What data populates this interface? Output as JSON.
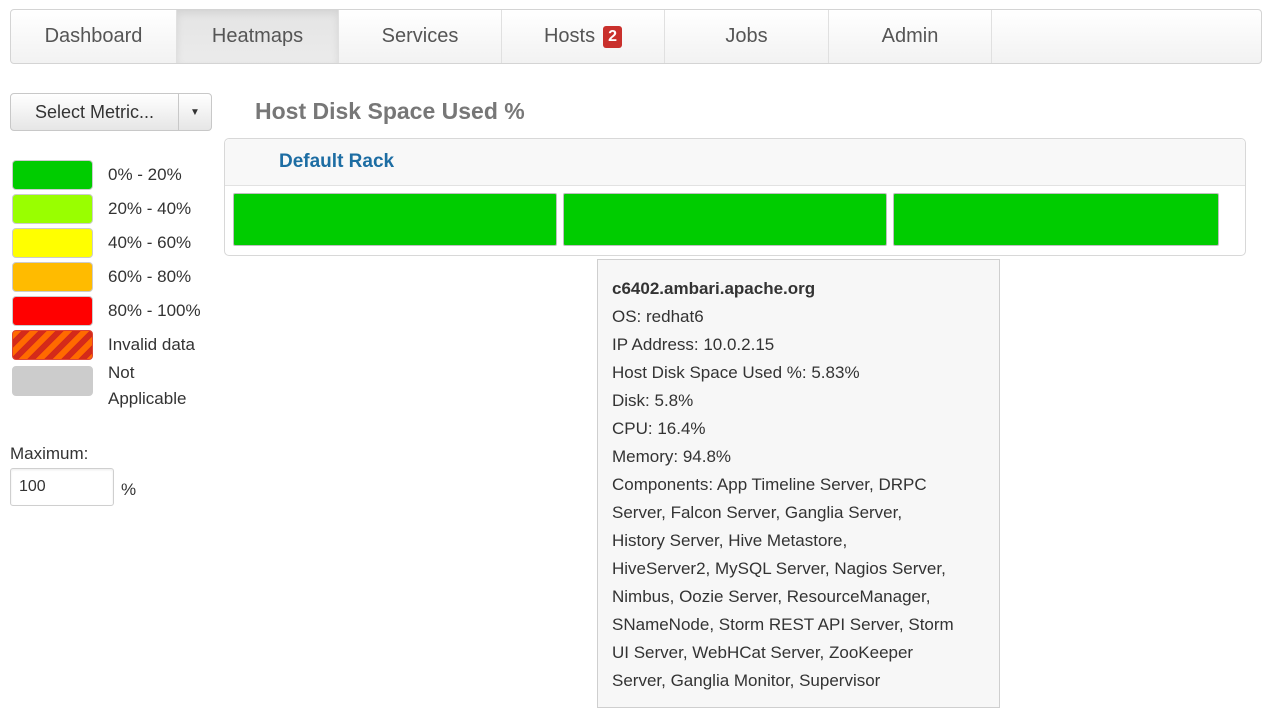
{
  "nav": {
    "items": [
      {
        "label": "Dashboard",
        "active": false
      },
      {
        "label": "Heatmaps",
        "active": true
      },
      {
        "label": "Services",
        "active": false
      },
      {
        "label": "Hosts",
        "active": false,
        "badge": "2"
      },
      {
        "label": "Jobs",
        "active": false
      },
      {
        "label": "Admin",
        "active": false
      }
    ]
  },
  "metric_select": {
    "label": "Select Metric..."
  },
  "legend": [
    {
      "label": "0% - 20%",
      "color": "#00cc00"
    },
    {
      "label": "20% - 40%",
      "color": "#99ff00"
    },
    {
      "label": "40% - 60%",
      "color": "#ffff00"
    },
    {
      "label": "60% - 80%",
      "color": "#ffbb00"
    },
    {
      "label": "80% - 100%",
      "color": "#ff0000"
    },
    {
      "label": "Invalid data",
      "color": "hatched"
    },
    {
      "label_line1": "Not",
      "label_line2": "Applicable",
      "color": "#cccccc"
    }
  ],
  "maximum": {
    "label": "Maximum:",
    "value": "100",
    "unit": "%"
  },
  "main": {
    "title": "Host Disk Space Used %",
    "rack": {
      "title": "Default Rack",
      "hosts": [
        {
          "color": "#00cc00"
        },
        {
          "color": "#00cc00"
        },
        {
          "color": "#00cc00"
        }
      ]
    }
  },
  "tooltip": {
    "host_name": "c6402.ambari.apache.org",
    "os": "OS: redhat6",
    "ip": "IP Address: 10.0.2.15",
    "metric": "Host Disk Space Used %: 5.83%",
    "disk": "Disk: 5.8%",
    "cpu": "CPU: 16.4%",
    "memory": "Memory: 94.8%",
    "components_lines": [
      "Components: App Timeline Server, DRPC",
      "Server, Falcon Server, Ganglia Server,",
      "History Server, Hive Metastore,",
      "HiveServer2, MySQL Server, Nagios Server,",
      "Nimbus, Oozie Server, ResourceManager,",
      "SNameNode, Storm REST API Server, Storm",
      "UI Server, WebHCat Server, ZooKeeper",
      "Server, Ganglia Monitor, Supervisor"
    ]
  }
}
